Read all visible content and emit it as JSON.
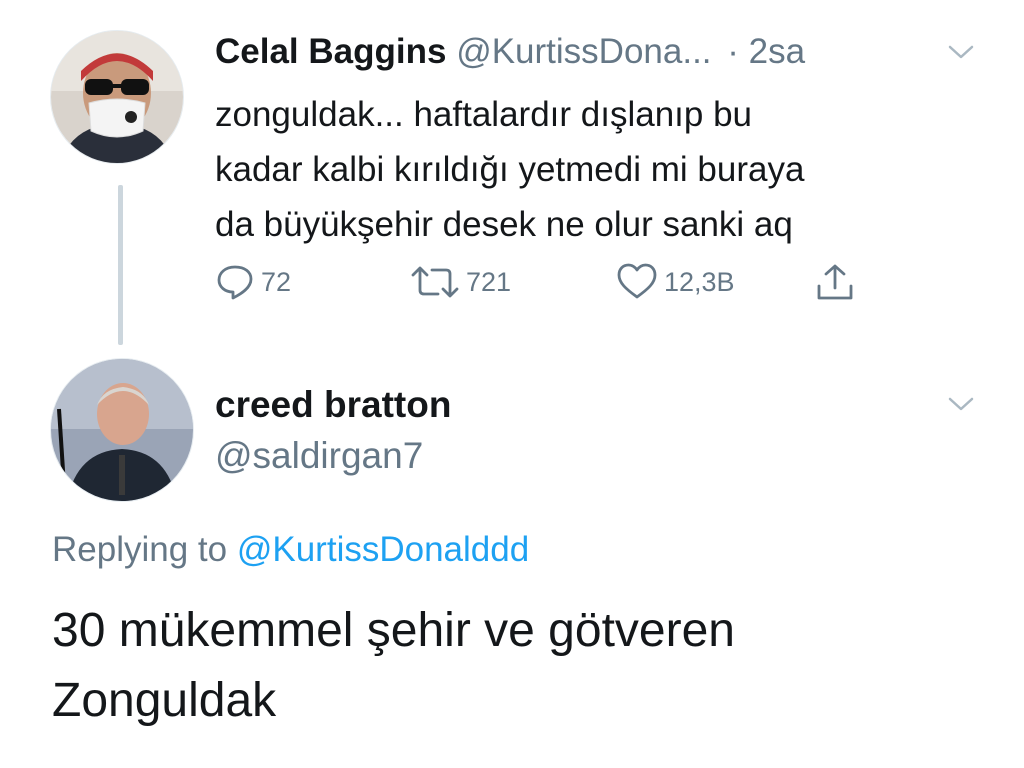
{
  "tweet": {
    "author_name": "Celal Baggins",
    "author_handle": "@KurtissDona...",
    "separator": "·",
    "time": "2sa",
    "text_lines": [
      "zonguldak... haftalardır dışlanıp bu",
      "kadar kalbi kırıldığı yetmedi mi buraya",
      "da büyükşehir desek ne olur sanki aq"
    ],
    "replies": "72",
    "retweets": "721",
    "likes": "12,3B"
  },
  "reply": {
    "author_name": "creed bratton",
    "author_handle": "@saldirgan7",
    "replying_label": "Replying to",
    "replying_to": "@KurtissDonalddd",
    "text_lines": [
      "30 mükemmel şehir ve götveren",
      "Zonguldak"
    ]
  },
  "colors": {
    "primary_text": "#14171a",
    "secondary_text": "#657786",
    "link": "#1da1f2",
    "thread_line": "#ccd6dd"
  },
  "icons": {
    "reply": "speech-bubble-icon",
    "retweet": "retweet-arrows-icon",
    "like": "heart-icon",
    "share": "share-upload-icon",
    "menu": "chevron-down-icon"
  }
}
